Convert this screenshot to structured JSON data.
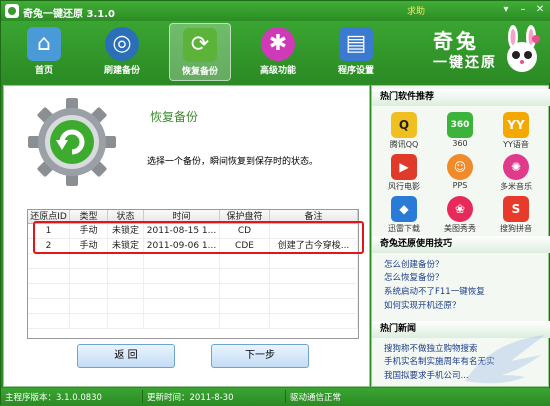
{
  "window": {
    "title": "奇兔一键还原 3.1.0",
    "help": "求助"
  },
  "nav": [
    {
      "label": "首页",
      "icon": "home-icon",
      "color": "#4a9ad8"
    },
    {
      "label": "刷建备份",
      "icon": "backup-disc-icon",
      "color": "#2a6fb8"
    },
    {
      "label": "恢复备份",
      "icon": "restore-gear-icon",
      "color": "#5bb33a",
      "active": true
    },
    {
      "label": "高级功能",
      "icon": "molecule-icon",
      "color": "#d03ab8"
    },
    {
      "label": "程序设置",
      "icon": "settings-screen-icon",
      "color": "#3a7ad0"
    }
  ],
  "brand": {
    "line1": "奇兔",
    "line2": "一键还原"
  },
  "main": {
    "title": "恢复备份",
    "description": "选择一个备份，瞬间恢复到保存时的状态。",
    "table": {
      "headers": [
        "还原点ID",
        "类型",
        "状态",
        "时间",
        "保护盘符",
        "备注"
      ],
      "rows": [
        [
          "1",
          "手动",
          "未锁定",
          "2011-08-15 1...",
          "CD",
          ""
        ],
        [
          "2",
          "手动",
          "未锁定",
          "2011-09-06 1...",
          "CDE",
          "创建了古今穿梭..."
        ]
      ]
    },
    "back_label": "返  回",
    "next_label": "下一步"
  },
  "sidebar": {
    "recommend_title": "热门软件推荐",
    "apps": [
      {
        "label": "腾讯QQ",
        "icon": "qq-icon",
        "color": "#e8e8e8",
        "glyph": "Q"
      },
      {
        "label": "360",
        "icon": "360-icon",
        "color": "#3cb43c",
        "glyph": "360"
      },
      {
        "label": "YY语音",
        "icon": "yy-icon",
        "color": "#f5a800",
        "glyph": "YY"
      },
      {
        "label": "风行电影",
        "icon": "fengxing-icon",
        "color": "#e03a2a",
        "glyph": "▶"
      },
      {
        "label": "PPS",
        "icon": "pps-icon",
        "color": "#f08a2a",
        "glyph": "☺"
      },
      {
        "label": "多米音乐",
        "icon": "duomi-icon",
        "color": "#e03a8a",
        "glyph": "✺"
      },
      {
        "label": "迅雷下载",
        "icon": "xunlei-icon",
        "color": "#2a7ad8",
        "glyph": "◆"
      },
      {
        "label": "美图秀秀",
        "icon": "meitu-icon",
        "color": "#e82a5a",
        "glyph": "❀"
      },
      {
        "label": "搜狗拼音",
        "icon": "sogou-icon",
        "color": "#e83a2a",
        "glyph": "S"
      }
    ],
    "tips_title": "奇兔还原使用技巧",
    "tips": [
      "怎么创建备份？",
      "怎么恢复备份？",
      "系统启动不了F11一键恢复",
      "如何实现开机还原？"
    ],
    "news_title": "热门新闻",
    "news": [
      "搜狗称不做独立购物搜索",
      "手机实名制实施周年有名无实",
      "我国拟要求手机公司..."
    ]
  },
  "status": {
    "version": "主程序版本：3.1.0.0830",
    "updated": "更新时间：2011-8-30",
    "driver": "驱动通信正常"
  }
}
